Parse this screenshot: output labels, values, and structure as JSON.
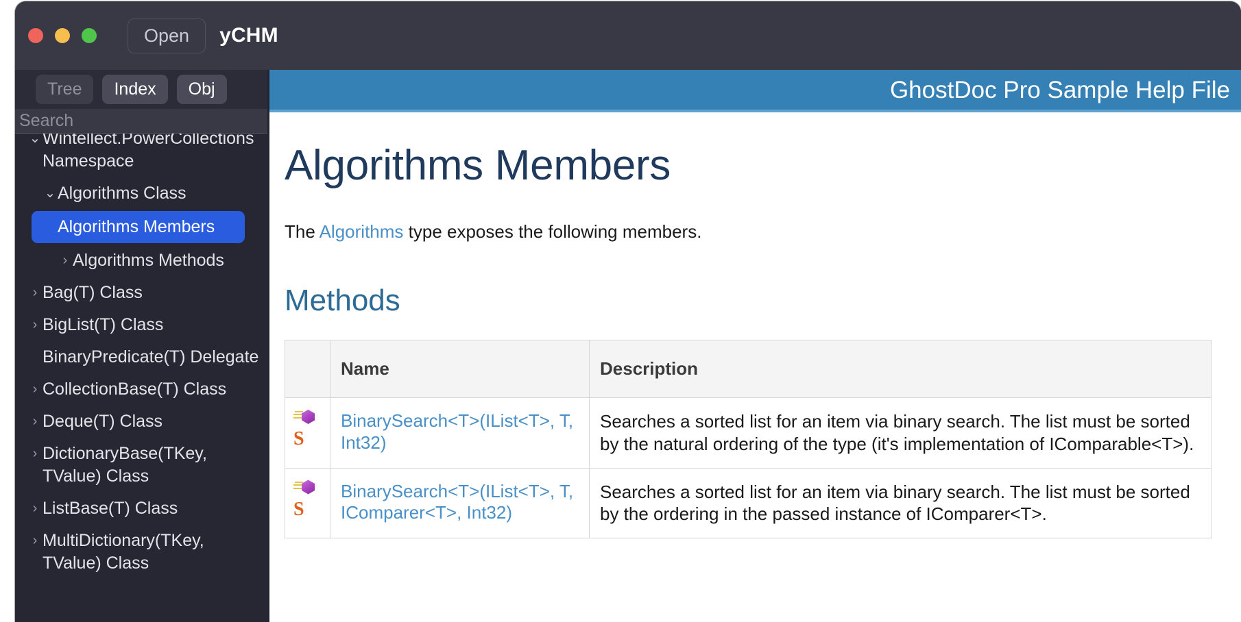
{
  "window": {
    "app_title": "yCHM",
    "open_button": "Open",
    "traffic_lights": [
      "close-red",
      "minimize-yellow",
      "maximize-green"
    ]
  },
  "sidebar": {
    "tabs": [
      {
        "label": "Tree",
        "active": false
      },
      {
        "label": "Index",
        "active": true
      },
      {
        "label": "Obj",
        "active": true
      }
    ],
    "search": {
      "placeholder": "Search",
      "value": ""
    },
    "tree": [
      {
        "label": "Wintellect.PowerCollections Namespace",
        "depth": 0,
        "chevron": "down",
        "selected": false,
        "clipped": true
      },
      {
        "label": "Algorithms Class",
        "depth": 1,
        "chevron": "down",
        "selected": false
      },
      {
        "label": "Algorithms Members",
        "depth": 2,
        "chevron": "none",
        "selected": true
      },
      {
        "label": "Algorithms Methods",
        "depth": 2,
        "chevron": "right",
        "selected": false
      },
      {
        "label": "Bag(T) Class",
        "depth": 1,
        "chevron": "right",
        "selected": false
      },
      {
        "label": "BigList(T) Class",
        "depth": 1,
        "chevron": "right",
        "selected": false
      },
      {
        "label": "BinaryPredicate(T) Delegate",
        "depth": 1,
        "chevron": "none",
        "selected": false
      },
      {
        "label": "CollectionBase(T) Class",
        "depth": 1,
        "chevron": "right",
        "selected": false
      },
      {
        "label": "Deque(T) Class",
        "depth": 1,
        "chevron": "right",
        "selected": false
      },
      {
        "label": "DictionaryBase(TKey, TValue) Class",
        "depth": 1,
        "chevron": "right",
        "selected": false
      },
      {
        "label": "ListBase(T) Class",
        "depth": 1,
        "chevron": "right",
        "selected": false
      },
      {
        "label": "MultiDictionary(TKey, TValue) Class",
        "depth": 1,
        "chevron": "right",
        "selected": false
      }
    ]
  },
  "document": {
    "header_title": "GhostDoc Pro Sample Help File",
    "page_title": "Algorithms Members",
    "intro": {
      "before": "The ",
      "link": "Algorithms",
      "after": " type exposes the following members."
    },
    "section_title": "Methods",
    "table": {
      "headers": {
        "icon": "",
        "name": "Name",
        "description": "Description"
      },
      "rows": [
        {
          "icons": [
            "public-method-icon",
            "static-member-icon"
          ],
          "name": "BinarySearch<T>(IList<T>, T, Int32)",
          "description": "Searches a sorted list for an item via binary search. The list must be sorted by the natural ordering of the type (it's implementation of IComparable<T>)."
        },
        {
          "icons": [
            "public-method-icon",
            "static-member-icon"
          ],
          "name": "BinarySearch<T>(IList<T>, T, IComparer<T>, Int32)",
          "description": "Searches a sorted list for an item via binary search. The list must be sorted by the ordering in the passed instance of IComparer<T>."
        }
      ]
    }
  },
  "colors": {
    "window_chrome": "#393945",
    "sidebar_bg": "#272733",
    "selection_blue": "#2A5CE0",
    "doc_header_blue": "#3580B4",
    "doc_header_underline": "#5FA3D0",
    "page_title_navy": "#1F3A5C",
    "section_title_blue": "#2C6B96",
    "link_blue": "#4A90C8",
    "method_icon_purple": "#A93FC0",
    "static_icon_orange": "#E1601C"
  }
}
